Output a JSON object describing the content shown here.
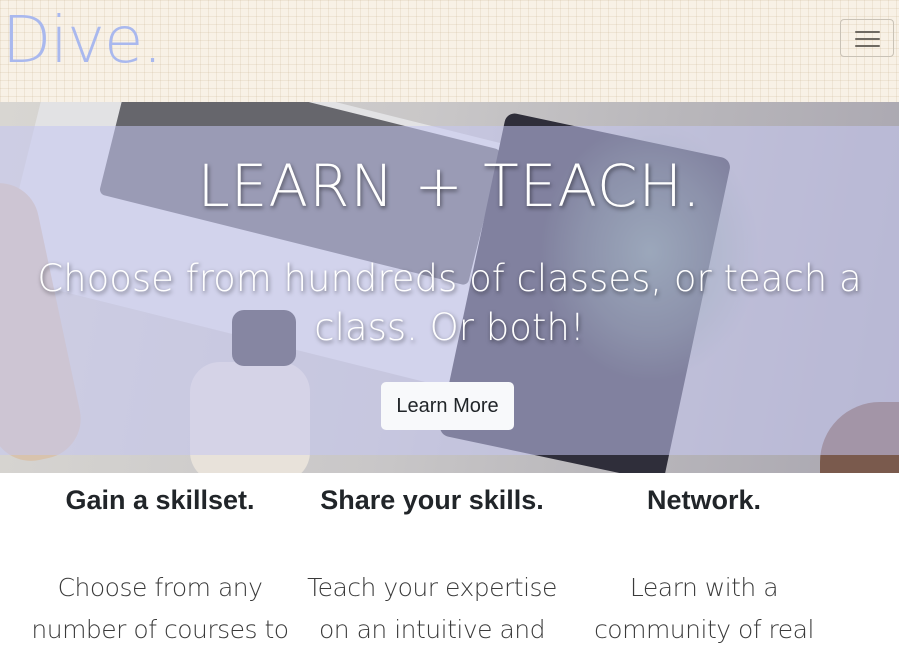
{
  "nav": {
    "brand": "Dive.",
    "menu_icon": "hamburger-menu-icon",
    "brand_color": "#a9b8ee"
  },
  "hero": {
    "title": "LEARN + TEACH.",
    "subtitle": "Choose from hundreds of classes, or teach a class. Or both!",
    "cta_label": "Learn More",
    "overlay_color": "#c4c6f2"
  },
  "features": [
    {
      "title": "Gain a skillset.",
      "body": "Choose from any number of courses to"
    },
    {
      "title": "Share your skills.",
      "body": "Teach your expertise on an intuitive and"
    },
    {
      "title": "Network.",
      "body": "Learn with a community of real"
    }
  ]
}
